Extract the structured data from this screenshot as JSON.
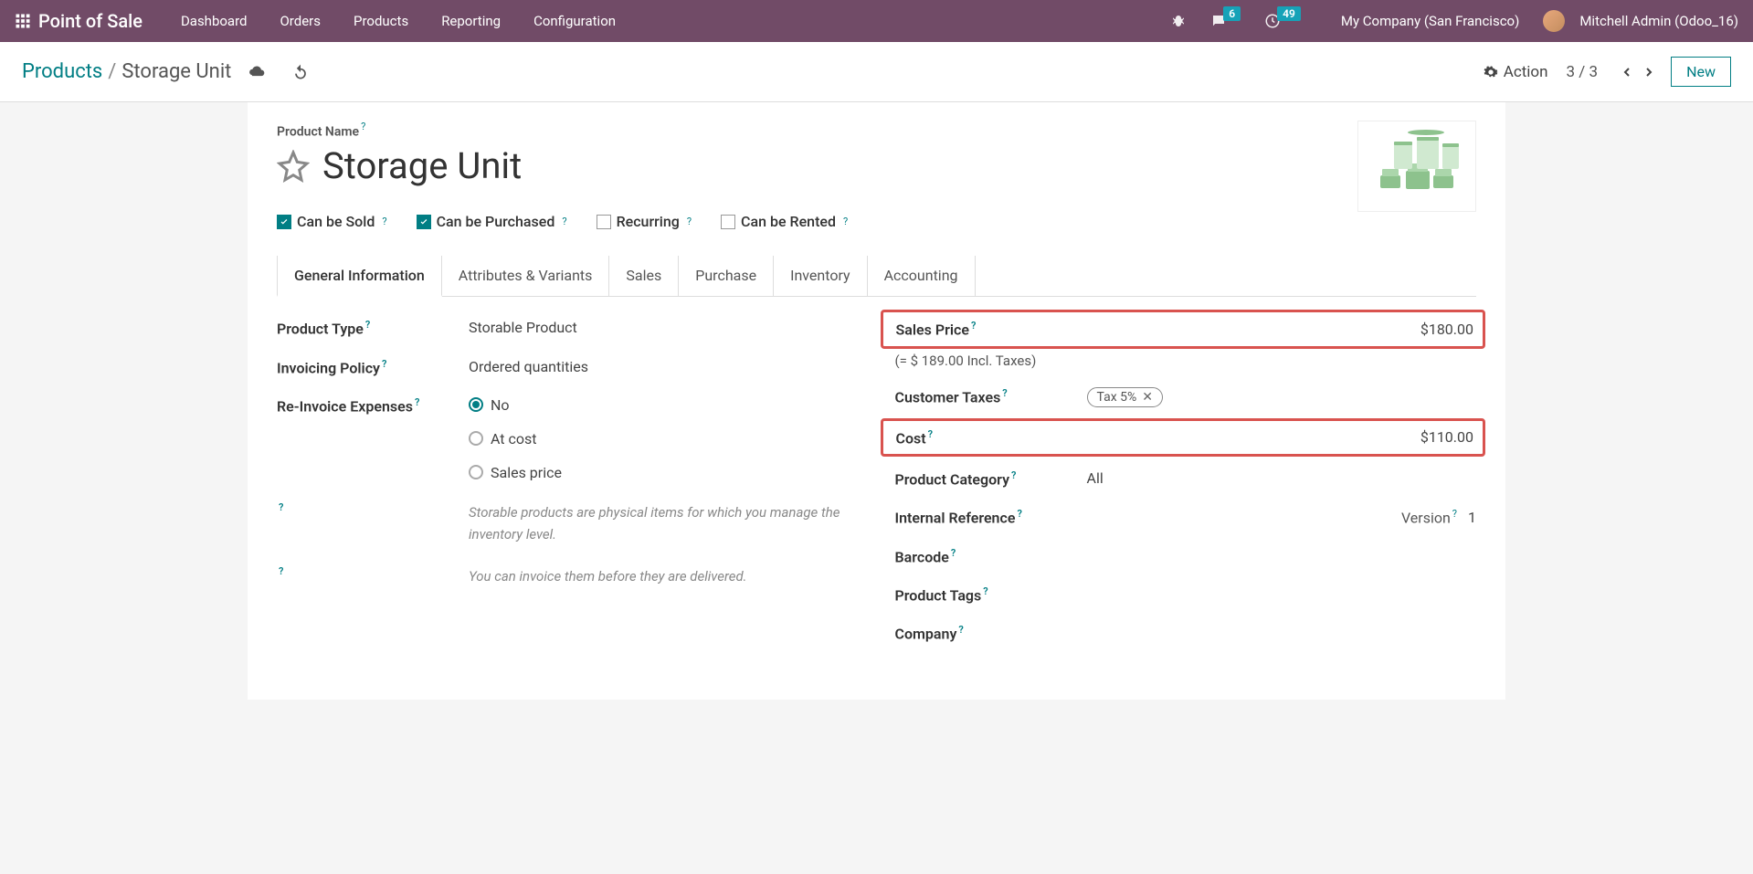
{
  "topbar": {
    "brand": "Point of Sale",
    "nav": [
      "Dashboard",
      "Orders",
      "Products",
      "Reporting",
      "Configuration"
    ],
    "msg_badge": "6",
    "activity_badge": "49",
    "company": "My Company (San Francisco)",
    "user": "Mitchell Admin (Odoo_16)"
  },
  "control": {
    "root": "Products",
    "current": "Storage Unit",
    "action": "Action",
    "pager": "3 / 3",
    "new": "New"
  },
  "product": {
    "name_label": "Product Name",
    "name": "Storage Unit",
    "checks": {
      "sold": "Can be Sold",
      "purchased": "Can be Purchased",
      "recurring": "Recurring",
      "rented": "Can be Rented"
    },
    "tabs": [
      "General Information",
      "Attributes & Variants",
      "Sales",
      "Purchase",
      "Inventory",
      "Accounting"
    ]
  },
  "left": {
    "type_label": "Product Type",
    "type_value": "Storable Product",
    "inv_label": "Invoicing Policy",
    "inv_value": "Ordered quantities",
    "reinv_label": "Re-Invoice Expenses",
    "r1": "No",
    "r2": "At cost",
    "r3": "Sales price",
    "help1": "Storable products are physical items for which you manage the inventory level.",
    "help2": "You can invoice them before they are delivered."
  },
  "right": {
    "sales_label": "Sales Price",
    "sales_value": "$180.00",
    "incl": "(= $ 189.00 Incl. Taxes)",
    "tax_label": "Customer Taxes",
    "tax_chip": "Tax 5%",
    "cost_label": "Cost",
    "cost_value": "$110.00",
    "cat_label": "Product Category",
    "cat_value": "All",
    "intref_label": "Internal Reference",
    "version_label": "Version",
    "version_value": "1",
    "barcode_label": "Barcode",
    "tags_label": "Product Tags",
    "company_label": "Company"
  }
}
